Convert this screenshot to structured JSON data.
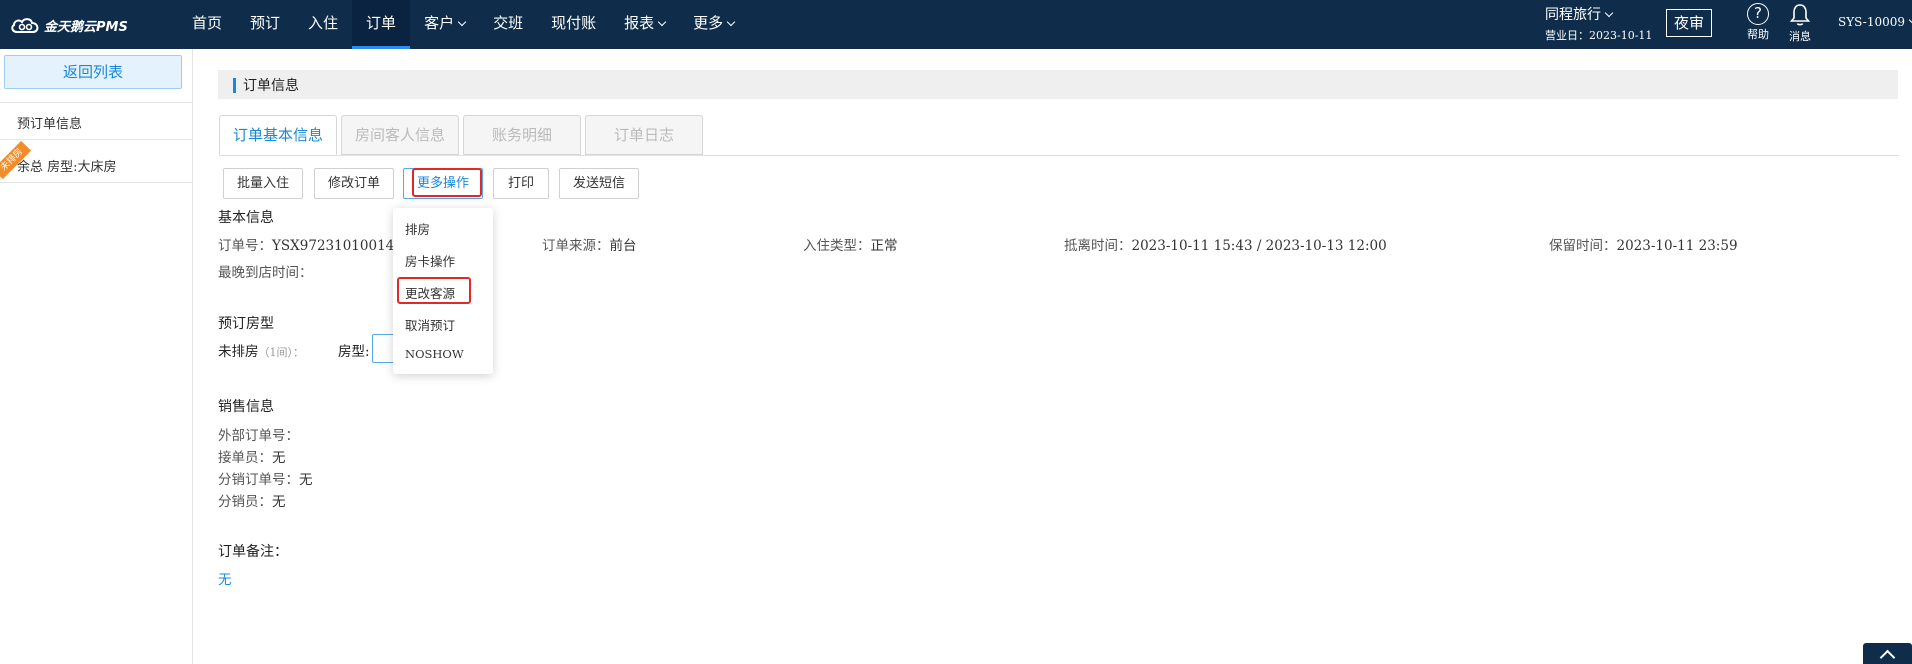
{
  "app": {
    "logo_text": "金天鹅云PMS"
  },
  "nav": {
    "items": [
      {
        "label": "首页",
        "active": false,
        "has_caret": false
      },
      {
        "label": "预订",
        "active": false,
        "has_caret": false
      },
      {
        "label": "入住",
        "active": false,
        "has_caret": false
      },
      {
        "label": "订单",
        "active": true,
        "has_caret": false
      },
      {
        "label": "客户",
        "active": false,
        "has_caret": true
      },
      {
        "label": "交班",
        "active": false,
        "has_caret": false
      },
      {
        "label": "现付账",
        "active": false,
        "has_caret": false
      },
      {
        "label": "报表",
        "active": false,
        "has_caret": true
      },
      {
        "label": "更多",
        "active": false,
        "has_caret": true
      }
    ]
  },
  "header_right": {
    "hotel_name": "同程旅行",
    "business_date": "营业日：2023-10-11",
    "night_audit_label": "夜审",
    "help_label": "帮助",
    "messages_label": "消息",
    "user": "SYS-10009"
  },
  "sidebar": {
    "back_label": "返回列表",
    "booking_info_label": "预订单信息",
    "ribbon_label": "未排房",
    "room_item_label": "余总  房型:大床房"
  },
  "panel": {
    "title": "订单信息"
  },
  "tabs": [
    {
      "label": "订单基本信息",
      "active": true
    },
    {
      "label": "房间客人信息",
      "active": false
    },
    {
      "label": "账务明细",
      "active": false
    },
    {
      "label": "订单日志",
      "active": false
    }
  ],
  "toolbar": {
    "batch_checkin": "批量入住",
    "modify_order": "修改订单",
    "more_actions": "更多操作",
    "print": "打印",
    "send_sms": "发送短信"
  },
  "dropdown": {
    "items": [
      "排房",
      "房卡操作",
      "更改客源",
      "取消预订",
      "NOSHOW"
    ]
  },
  "basic_info": {
    "section_title": "基本信息",
    "order_no_label": "订单号：",
    "order_no": "YSX97231010014",
    "source_label": "订单来源：",
    "source": "前台",
    "checkin_type_label": "入住类型：",
    "checkin_type": "正常",
    "stay_label": "抵离时间：",
    "stay": "2023-10-11 15:43 / 2023-10-13 12:00",
    "hold_label": "保留时间：",
    "hold": "2023-10-11 23:59",
    "latest_arrival_label": "最晚到店时间："
  },
  "booking_rooms": {
    "section_title": "预订房型",
    "unassigned_label": "未排房",
    "unassigned_count": "（1间）：",
    "room_type_label": "房型:"
  },
  "sales_info": {
    "section_title": "销售信息",
    "external_order_label": "外部订单号：",
    "receiver_label": "接单员：",
    "receiver": "无",
    "dist_order_label": "分销订单号：",
    "dist_order": "无",
    "distributor_label": "分销员：",
    "distributor": "无"
  },
  "remarks": {
    "section_title": "订单备注：",
    "value": "无"
  },
  "colors": {
    "nav_bg": "#0f2d4b",
    "accent": "#1a88d8",
    "highlight_box": "#e02a2a",
    "ribbon": "#f08d2a"
  }
}
